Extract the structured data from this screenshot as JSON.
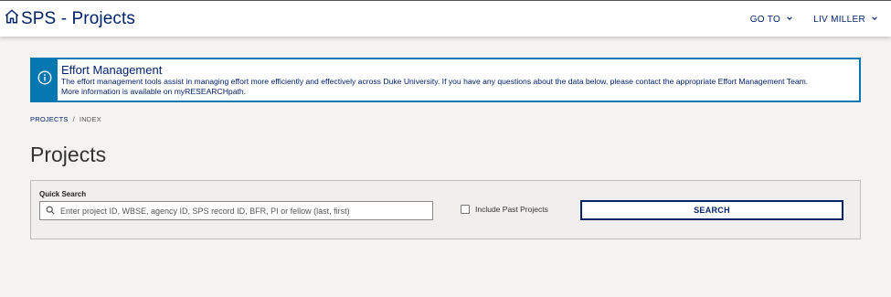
{
  "header": {
    "title": "SPS - Projects",
    "home_icon": "home-icon",
    "nav": {
      "goto_label": "GO TO",
      "user_label": "LIV MILLER"
    }
  },
  "alert": {
    "icon": "info-icon",
    "title": "Effort Management",
    "line1": "The effort management tools assist in managing effort more efficiently and effectively across Duke University. If you have any questions about the data below, please contact the appropriate Effort Management Team.",
    "line2": "More information is available on myRESEARCHpath."
  },
  "breadcrumb": {
    "items": [
      "PROJECTS",
      "INDEX"
    ],
    "separator": "/"
  },
  "page": {
    "title": "Projects"
  },
  "search": {
    "label": "Quick Search",
    "placeholder": "Enter project ID, WBSE, agency ID, SPS record ID, BFR, PI or fellow (last, first)",
    "value": "",
    "include_past_label": "Include Past Projects",
    "include_past_checked": false,
    "button_label": "SEARCH"
  },
  "colors": {
    "brand_navy": "#012169",
    "info_blue": "#0577b1",
    "background": "#f4f3f2"
  }
}
